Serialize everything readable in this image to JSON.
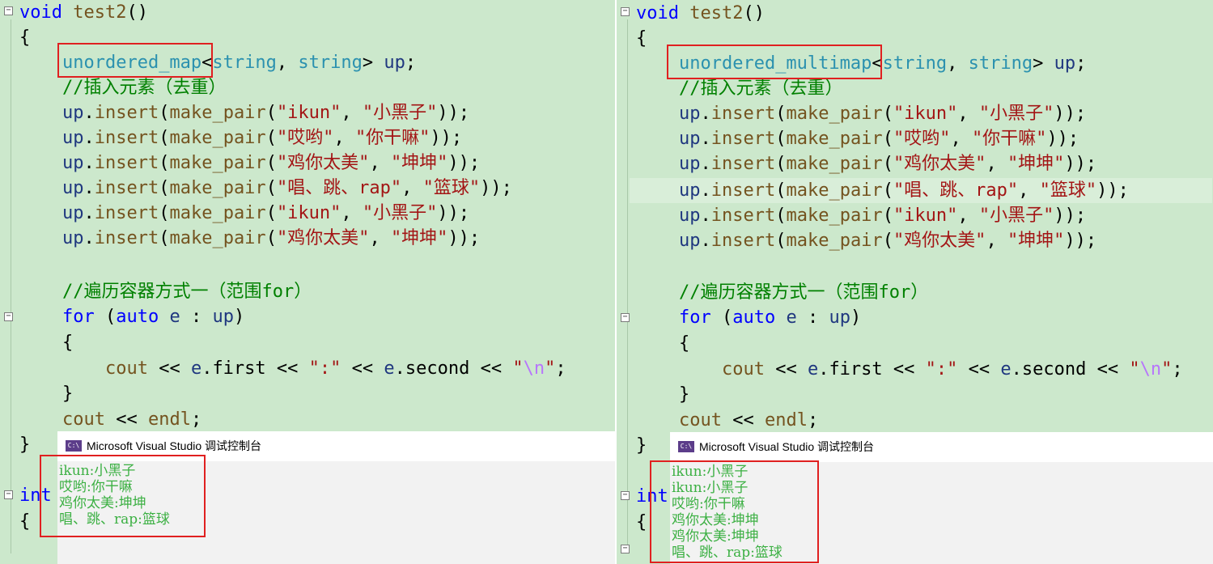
{
  "left": {
    "code": {
      "sig_kw": "void",
      "sig_fn": "test2",
      "sig_paren": "()",
      "open_brace": "{",
      "decl_type": "unordered_map",
      "decl_lt": "<",
      "decl_t1": "string",
      "decl_comma": ", ",
      "decl_t2": "string",
      "decl_gt": ">",
      "decl_var": " up",
      "semi": ";",
      "comment1": "//插入元素（去重）",
      "inserts": [
        {
          "k": "\"ikun\"",
          "v": "\"小黑子\""
        },
        {
          "k": "\"哎哟\"",
          "v": "\"你干嘛\""
        },
        {
          "k": "\"鸡你太美\"",
          "v": "\"坤坤\""
        },
        {
          "k": "\"唱、跳、rap\"",
          "v": "\"篮球\""
        },
        {
          "k": "\"ikun\"",
          "v": "\"小黑子\""
        },
        {
          "k": "\"鸡你太美\"",
          "v": "\"坤坤\""
        }
      ],
      "ins_obj": "up",
      "ins_dot": ".",
      "ins_fn": "insert",
      "ins_open": "(",
      "ins_mp": "make_pair",
      "ins_sep": ", ",
      "ins_close": "));",
      "comment2": "//遍历容器方式一（范围for）",
      "for_kw": "for",
      "for_open": " (",
      "auto_kw": "auto",
      "for_var": " e",
      "for_colon": " : ",
      "for_range": "up",
      "for_close": ")",
      "inner_open": "{",
      "cout": "cout",
      "op": " << ",
      "e": "e",
      "dot": ".",
      "first": "first",
      "colon_str": "\":\"",
      "second": "second",
      "nl_q1": "\"",
      "nl_esc": "\\n",
      "nl_q2": "\"",
      "inner_close": "}",
      "endl": "endl",
      "close_brace": "}",
      "int_kw": "int",
      "main_open": "{"
    },
    "console": {
      "title": "Microsoft Visual Studio 调试控制台",
      "icon": "C:\\",
      "lines": [
        "ikun:小黑子",
        "哎哟:你干嘛",
        "鸡你太美:坤坤",
        "唱、跳、rap:篮球"
      ]
    }
  },
  "right": {
    "code": {
      "decl_type": "unordered_multimap"
    },
    "console": {
      "title": "Microsoft Visual Studio 调试控制台",
      "icon": "C:\\",
      "lines": [
        "ikun:小黑子",
        "ikun:小黑子",
        "哎哟:你干嘛",
        "鸡你太美:坤坤",
        "鸡你太美:坤坤",
        "唱、跳、rap:篮球"
      ]
    }
  },
  "colors": {
    "editor_bg": "#cce8cc",
    "keyword": "#0000ff",
    "type": "#2b91af",
    "string": "#a31515",
    "comment": "#008000",
    "console_text": "#3cb043",
    "highlight_box": "#e02020"
  }
}
